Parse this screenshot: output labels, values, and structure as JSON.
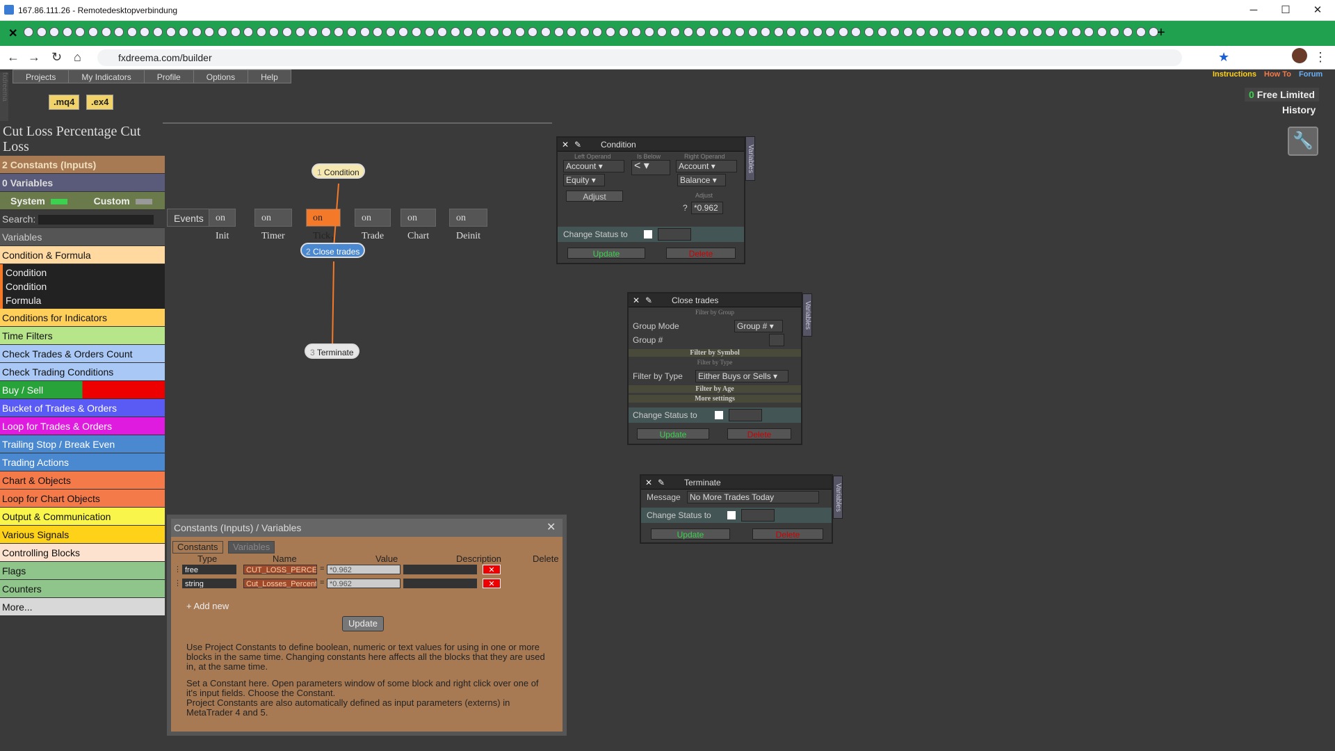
{
  "window": {
    "title": "167.86.111.26 - Remotedesktopverbindung",
    "min": "─",
    "max": "☐",
    "close": "✕"
  },
  "browser": {
    "url": "fxdreema.com/builder",
    "tab_close": "✕",
    "new_tab": "+"
  },
  "menu": [
    "Projects",
    "My Indicators",
    "Profile",
    "Options",
    "Help"
  ],
  "links": {
    "instructions": "Instructions",
    "howto": "How To",
    "forum": "Forum"
  },
  "account": {
    "count": "0",
    "plan": "Free Limited",
    "history": "History"
  },
  "ext": {
    "mq4": ".mq4",
    "ex4": ".ex4"
  },
  "project": {
    "title": "Cut Loss Percentage Cut Loss"
  },
  "side": {
    "constants_count": "2",
    "constants": "Constants (Inputs)",
    "variables_count": "0",
    "variables": "Variables",
    "system": "System",
    "custom": "Custom",
    "search": "Search:",
    "section": "Variables",
    "items": [
      {
        "label": "Condition & Formula",
        "color": "#ffd9a0"
      },
      {
        "label": "Conditions for Indicators",
        "color": "#ffcf5a"
      },
      {
        "label": "Time Filters",
        "color": "#b7e58a"
      },
      {
        "label": "Check Trades & Orders Count",
        "color": "#a9c8f5"
      },
      {
        "label": "Check Trading Conditions",
        "color": "#a9c8f5"
      },
      {
        "label": "Buy / Sell",
        "color": "#27a33a"
      },
      {
        "label": "Bucket of Trades & Orders",
        "color": "#5a5af5"
      },
      {
        "label": "Loop for Trades & Orders",
        "color": "#e01be0"
      },
      {
        "label": "Trailing Stop / Break Even",
        "color": "#4a88d0"
      },
      {
        "label": "Trading Actions",
        "color": "#4a88d0"
      },
      {
        "label": "Chart & Objects",
        "color": "#f47a4a"
      },
      {
        "label": "Loop for Chart Objects",
        "color": "#f47a4a"
      },
      {
        "label": "Output & Communication",
        "color": "#f9f54a"
      },
      {
        "label": "Various Signals",
        "color": "#ffd21a"
      },
      {
        "label": "Controlling Blocks",
        "color": "#fde3cf"
      },
      {
        "label": "Flags",
        "color": "#8fc48a"
      },
      {
        "label": "Counters",
        "color": "#8fc48a"
      },
      {
        "label": "More...",
        "color": "#d8d8d8"
      }
    ],
    "sub": [
      "Condition",
      "Condition",
      "Formula"
    ]
  },
  "events": [
    "Events",
    "on Init",
    "on Timer",
    "on Tick",
    "on Trade",
    "on Chart",
    "on Deinit"
  ],
  "events_tick_count": "3",
  "nodes": [
    {
      "n": "1",
      "label": "Condition"
    },
    {
      "n": "2",
      "label": "Close trades"
    },
    {
      "n": "3",
      "label": "Terminate"
    }
  ],
  "cond": {
    "title": "Condition",
    "left_operand": "Left Operand",
    "is_below": "Is Below",
    "right_operand": "Right Operand",
    "acc1": "Account",
    "eq": "Equity",
    "adjust": "Adjust",
    "op": "<",
    "acc2": "Account",
    "bal": "Balance",
    "adjust2": "Adjust",
    "q": "?",
    "val": "*0.962",
    "change": "Change Status to",
    "update": "Update",
    "delete": "Delete",
    "vars": "Variables"
  },
  "close": {
    "title": "Close trades",
    "filter_group": "Filter by Group",
    "group_mode": "Group Mode",
    "group_mode_val": "Group #",
    "group_num": "Group #",
    "filter_symbol": "Filter by Symbol",
    "filter_type": "Filter by Type",
    "filter_type_label": "Filter by Type",
    "filter_type_val": "Either Buys or Sells",
    "filter_age": "Filter by Age",
    "more": "More settings",
    "change": "Change Status to",
    "update": "Update",
    "delete": "Delete",
    "vars": "Variables"
  },
  "term": {
    "title": "Terminate",
    "msg_label": "Message",
    "msg": "No More Trades Today",
    "change": "Change Status to",
    "update": "Update",
    "delete": "Delete",
    "vars": "Variables"
  },
  "cv": {
    "title": "Constants (Inputs) / Variables",
    "tab1": "Constants",
    "tab2": "Variables",
    "h_type": "Type",
    "h_name": "Name",
    "h_value": "Value",
    "h_desc": "Description",
    "h_del": "Delete",
    "rows": [
      {
        "type": "free",
        "name": "CUT_LOSS_PERCENTA",
        "value": "*0.962"
      },
      {
        "type": "string",
        "name": "Cut_Losses_Percentag",
        "value": "*0.962"
      }
    ],
    "add": "+ Add new",
    "update": "Update",
    "p1": "Use Project Constants to define boolean, numeric or text values for using in one or more blocks in the same time. Changing constants here affects all the blocks that they are used in, at the same time.",
    "p2": "Set a Constant here. Open parameters window of some block and right click over one of it's input fields. Choose the Constant.",
    "p3": "Project Constants are also automatically defined as input parameters (externs) in MetaTrader 4 and 5."
  }
}
